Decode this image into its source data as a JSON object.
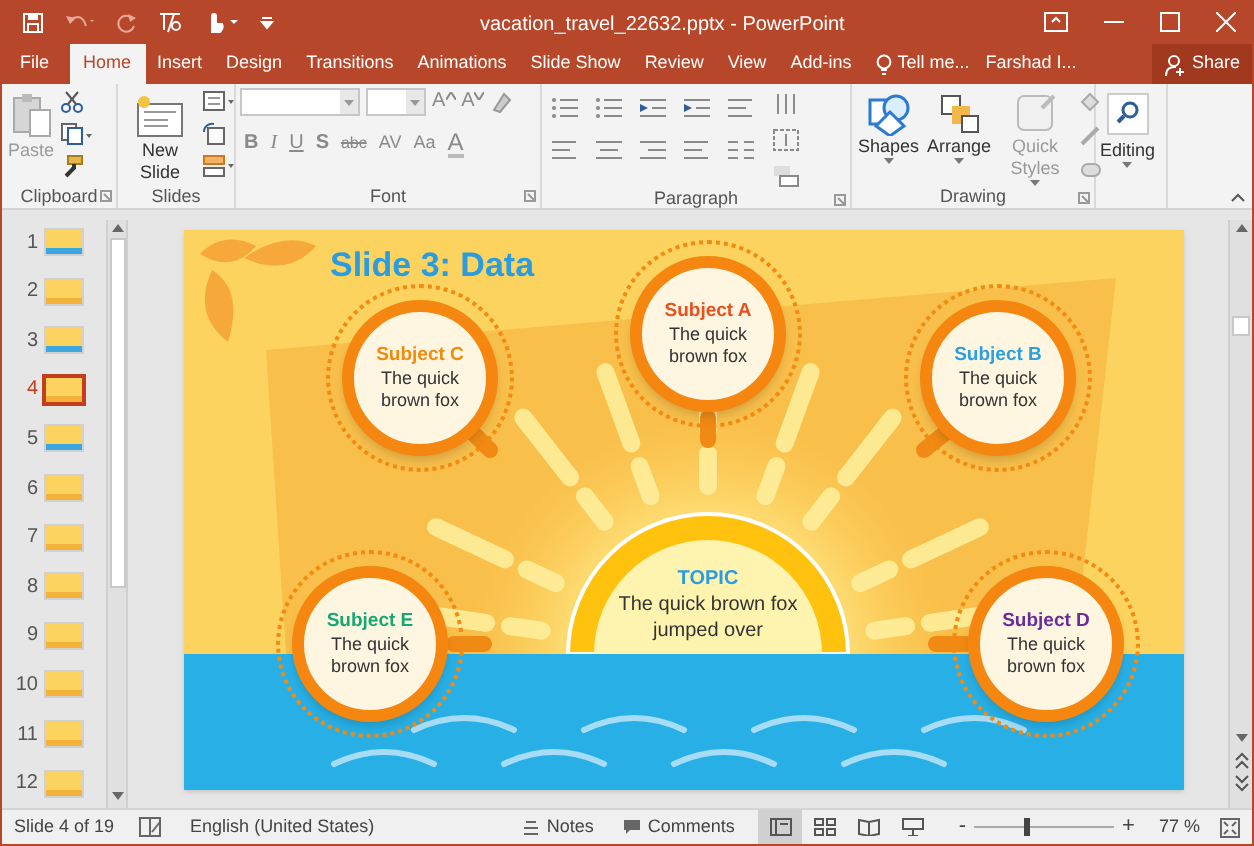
{
  "window": {
    "title": "vacation_travel_22632.pptx - PowerPoint"
  },
  "tabs": [
    {
      "label": "File",
      "selected": false
    },
    {
      "label": "Home",
      "selected": true
    },
    {
      "label": "Insert",
      "selected": false
    },
    {
      "label": "Design",
      "selected": false
    },
    {
      "label": "Transitions",
      "selected": false
    },
    {
      "label": "Animations",
      "selected": false
    },
    {
      "label": "Slide Show",
      "selected": false
    },
    {
      "label": "Review",
      "selected": false
    },
    {
      "label": "View",
      "selected": false
    },
    {
      "label": "Add-ins",
      "selected": false
    }
  ],
  "tell_me": "Tell me...",
  "user": "Farshad I...",
  "share": "Share",
  "ribbon": [
    {
      "kind": "clipboard",
      "label": "Clipboard",
      "buttons": [
        {
          "label": "Paste",
          "disabled": true
        }
      ]
    },
    {
      "kind": "slides",
      "label": "Slides",
      "buttons": [
        {
          "label": "New Slide",
          "disabled": false
        }
      ]
    },
    {
      "kind": "font",
      "label": "Font",
      "size_buttons": [
        "A",
        "A"
      ],
      "format_buttons": [
        "B",
        "I",
        "U",
        "S",
        "abc",
        "AV",
        "Aa",
        "A"
      ]
    },
    {
      "kind": "paragraph",
      "label": "Paragraph"
    },
    {
      "kind": "drawing",
      "label": "Drawing",
      "buttons": [
        {
          "label": "Shapes",
          "disabled": false
        },
        {
          "label": "Arrange",
          "disabled": false
        },
        {
          "label": "Quick Styles",
          "disabled": true
        }
      ]
    },
    {
      "kind": "editing",
      "buttons": [
        {
          "label": "Editing",
          "disabled": false
        }
      ]
    }
  ],
  "thumbnails": [
    {
      "number": "1",
      "selected": false
    },
    {
      "number": "2",
      "selected": false
    },
    {
      "number": "3",
      "selected": false
    },
    {
      "number": "4",
      "selected": true
    },
    {
      "number": "5",
      "selected": false
    },
    {
      "number": "6",
      "selected": false
    },
    {
      "number": "7",
      "selected": false
    },
    {
      "number": "8",
      "selected": false
    },
    {
      "number": "9",
      "selected": false
    },
    {
      "number": "10",
      "selected": false
    },
    {
      "number": "11",
      "selected": false
    },
    {
      "number": "12",
      "selected": false
    }
  ],
  "slide": {
    "title": "Slide 3: Data",
    "subjects": [
      {
        "label": "Subject A",
        "text": "The quick brown fox",
        "color": "#e8501e"
      },
      {
        "label": "Subject C",
        "text": "The quick brown fox",
        "color": "#f28a0c"
      },
      {
        "label": "Subject B",
        "text": "The quick brown fox",
        "color": "#2b9fe0"
      },
      {
        "label": "Subject E",
        "text": "The quick brown fox",
        "color": "#16a874"
      },
      {
        "label": "Subject D",
        "text": "The quick brown fox",
        "color": "#6a2c9a"
      }
    ],
    "topic": {
      "label": "TOPIC",
      "text": "The quick brown fox jumped over"
    }
  },
  "status_bar": {
    "slide_counter": "Slide 4 of 19",
    "language": "English (United States)",
    "notes": "Notes",
    "comments": "Comments",
    "views": [
      {
        "kind": "normal",
        "selected": true
      },
      {
        "kind": "sorter",
        "selected": false
      },
      {
        "kind": "reading",
        "selected": false
      },
      {
        "kind": "slideshow",
        "selected": false
      }
    ],
    "zoom_out": "-",
    "zoom_in": "+",
    "zoom": {
      "level": 0.37
    },
    "zoom_text": "77 %"
  }
}
